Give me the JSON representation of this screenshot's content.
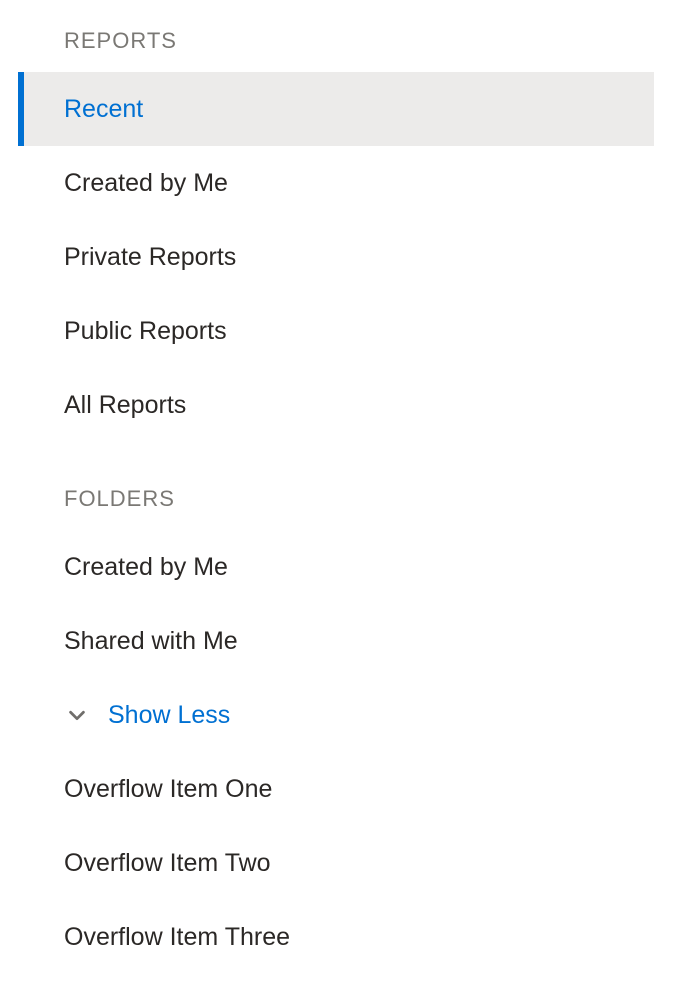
{
  "sections": {
    "reports": {
      "header": "REPORTS",
      "items": [
        {
          "label": "Recent",
          "selected": true
        },
        {
          "label": "Created by Me",
          "selected": false
        },
        {
          "label": "Private Reports",
          "selected": false
        },
        {
          "label": "Public Reports",
          "selected": false
        },
        {
          "label": "All Reports",
          "selected": false
        }
      ]
    },
    "folders": {
      "header": "FOLDERS",
      "items": [
        {
          "label": "Created by Me",
          "selected": false
        },
        {
          "label": "Shared with Me",
          "selected": false
        }
      ],
      "toggle_label": "Show Less",
      "overflow": [
        {
          "label": "Overflow Item One"
        },
        {
          "label": "Overflow Item Two"
        },
        {
          "label": "Overflow Item Three"
        }
      ]
    }
  }
}
